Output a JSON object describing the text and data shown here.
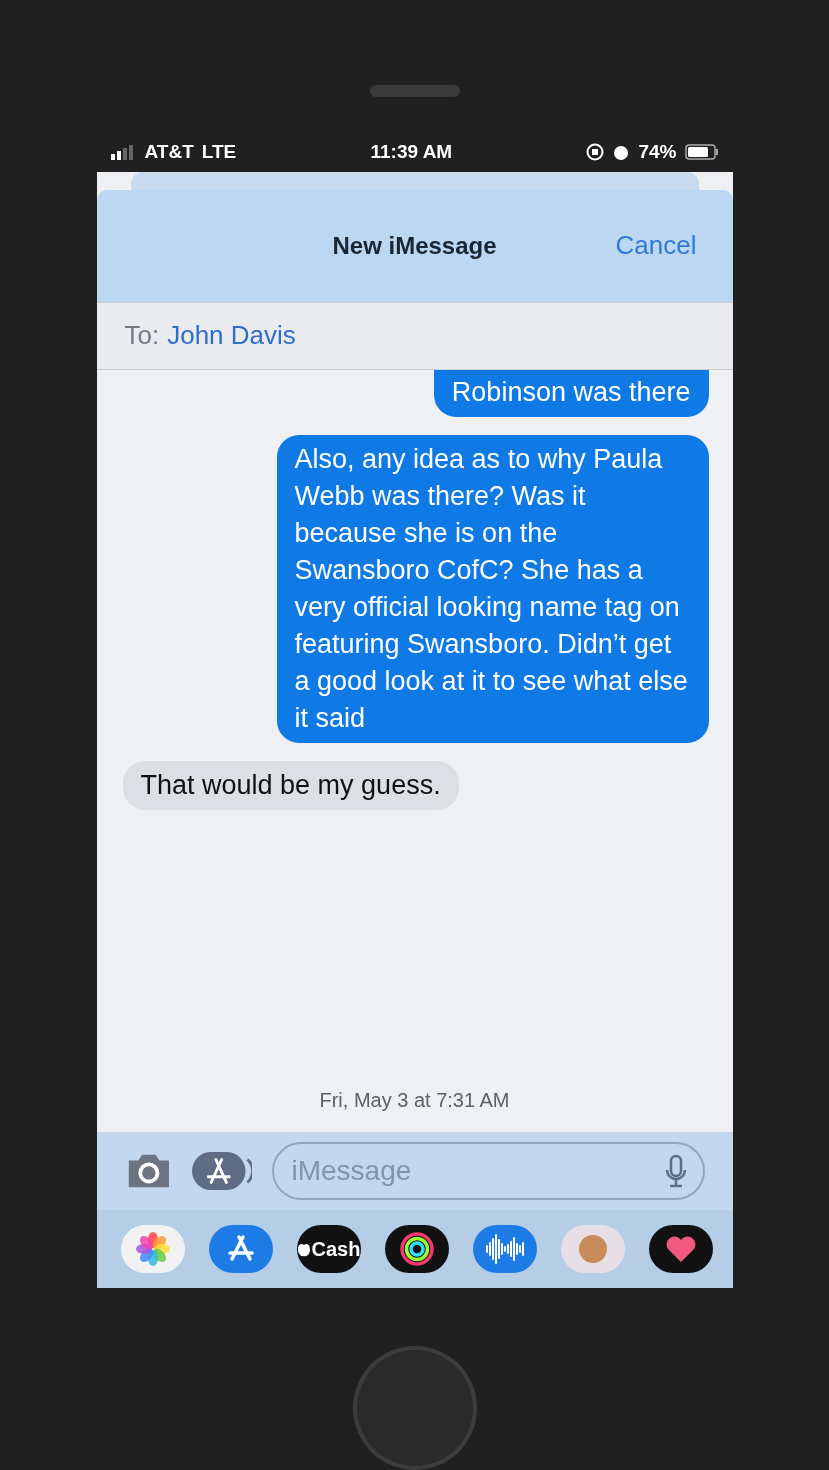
{
  "status_bar": {
    "carrier": "AT&T",
    "network": "LTE",
    "time": "11:39 AM",
    "battery": "74%"
  },
  "header": {
    "title": "New iMessage",
    "cancel": "Cancel"
  },
  "recipient": {
    "label": "To:",
    "name": "John Davis"
  },
  "messages": [
    {
      "kind": "sent",
      "text": "Robinson was there"
    },
    {
      "kind": "sent",
      "text": "Also, any idea as to why Paula Webb was there? Was it because she is  on the Swansboro CofC? She has a very official looking name tag on featuring Swansboro. Didn’t get a good look at it to see what else it said"
    },
    {
      "kind": "received",
      "text": "That would be my guess."
    }
  ],
  "timestamp": "Fri, May 3 at 7:31 AM",
  "composer": {
    "placeholder": "iMessage"
  },
  "apps": [
    {
      "kind": "photos"
    },
    {
      "kind": "store"
    },
    {
      "kind": "cash",
      "label": "Cash"
    },
    {
      "kind": "rings"
    },
    {
      "kind": "audio"
    },
    {
      "kind": "memoji"
    },
    {
      "kind": "heart"
    }
  ]
}
